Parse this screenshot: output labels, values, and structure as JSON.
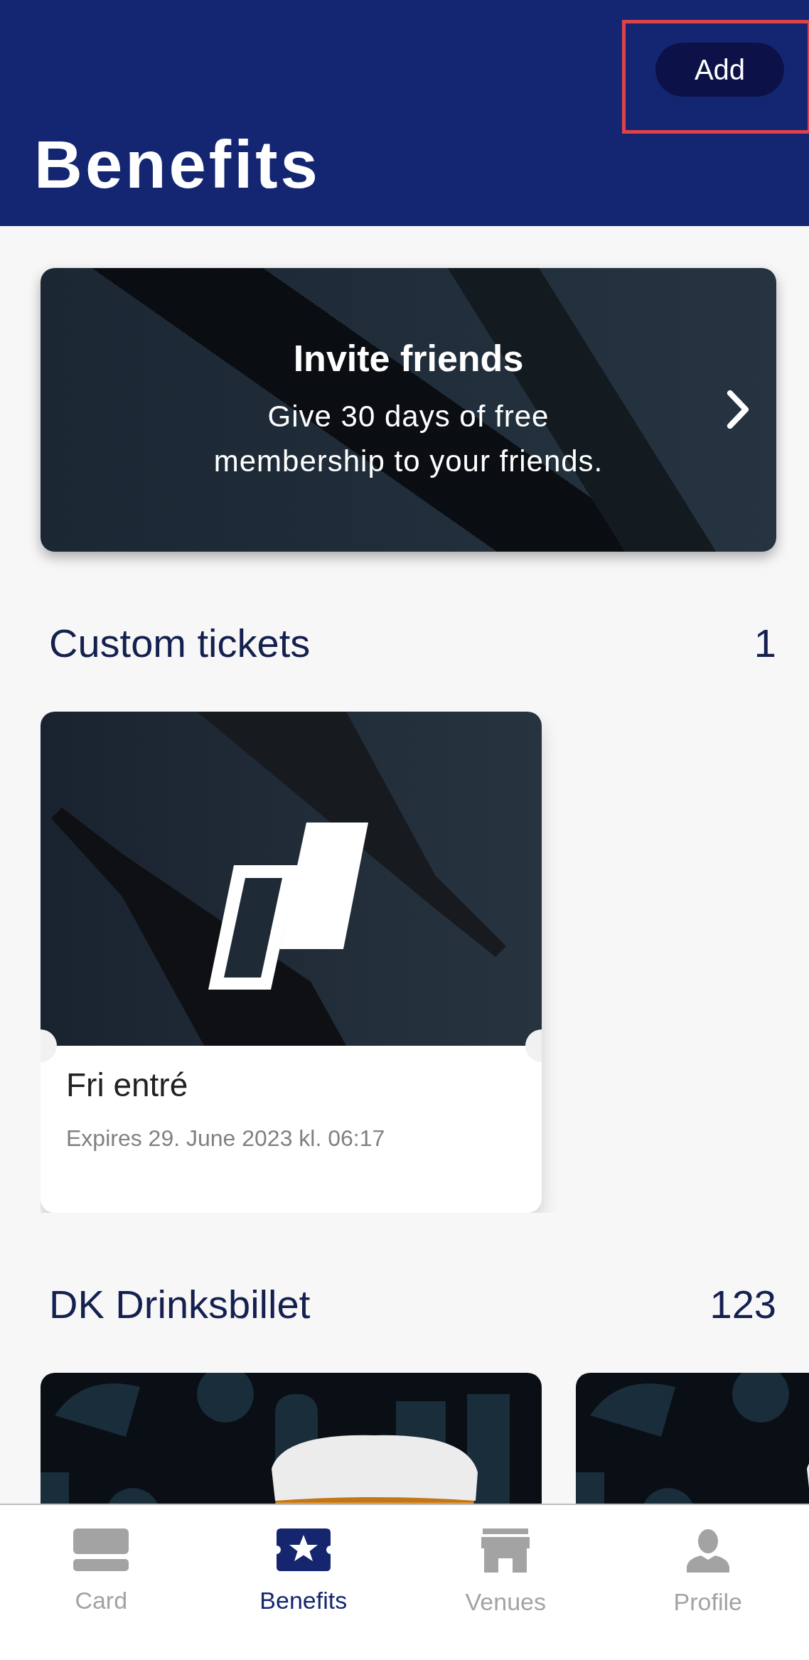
{
  "header": {
    "title": "Benefits",
    "action": "Add"
  },
  "invite_banner": {
    "title": "Invite friends",
    "text": "Give 30 days of free membership to your friends."
  },
  "sections": [
    {
      "title": "Custom tickets",
      "count": "1",
      "kind": "tickets",
      "items": [
        {
          "title": "Fri entré",
          "expiry": "Expires 29. June 2023 kl. 06:17"
        }
      ]
    },
    {
      "title": "DK Drinksbillet",
      "count": "123",
      "kind": "drinks"
    }
  ],
  "tab_bar": [
    {
      "label": "Card",
      "selected": false
    },
    {
      "label": "Benefits",
      "selected": true
    },
    {
      "label": "Venues",
      "selected": false
    },
    {
      "label": "Profile",
      "selected": false
    }
  ]
}
